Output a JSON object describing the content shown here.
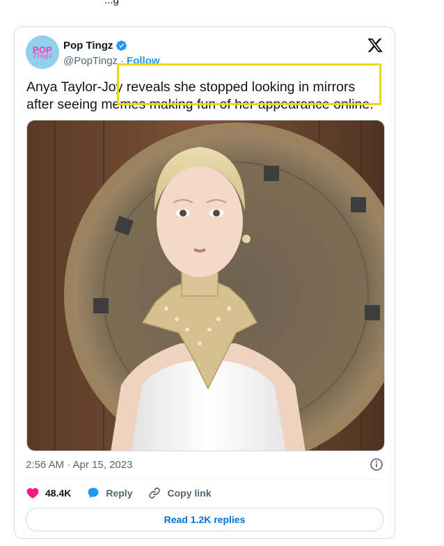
{
  "above_text": "...g",
  "tweet": {
    "display_name": "Pop Tingz",
    "handle": "@PopTingz",
    "separator": "·",
    "follow_label": "Follow",
    "avatar_text_top": "POP",
    "avatar_text_bottom": "Tingz",
    "text": "Anya Taylor-Joy reveals she stopped looking in mirrors\nafter seeing memes making fun of her appearance online.",
    "timestamp": "2:56 AM · Apr 15, 2023",
    "likes": "48.4K",
    "reply_label": "Reply",
    "copy_link_label": "Copy link",
    "read_replies_label": "Read 1.2K replies"
  },
  "colors": {
    "accent": "#1d9bf0",
    "like": "#f91880",
    "highlight_box": "#f2d600",
    "muted_text": "#536471"
  },
  "icons": [
    "verified-badge-icon",
    "x-logo-icon",
    "info-icon",
    "heart-icon",
    "reply-bubble-icon",
    "link-icon"
  ]
}
